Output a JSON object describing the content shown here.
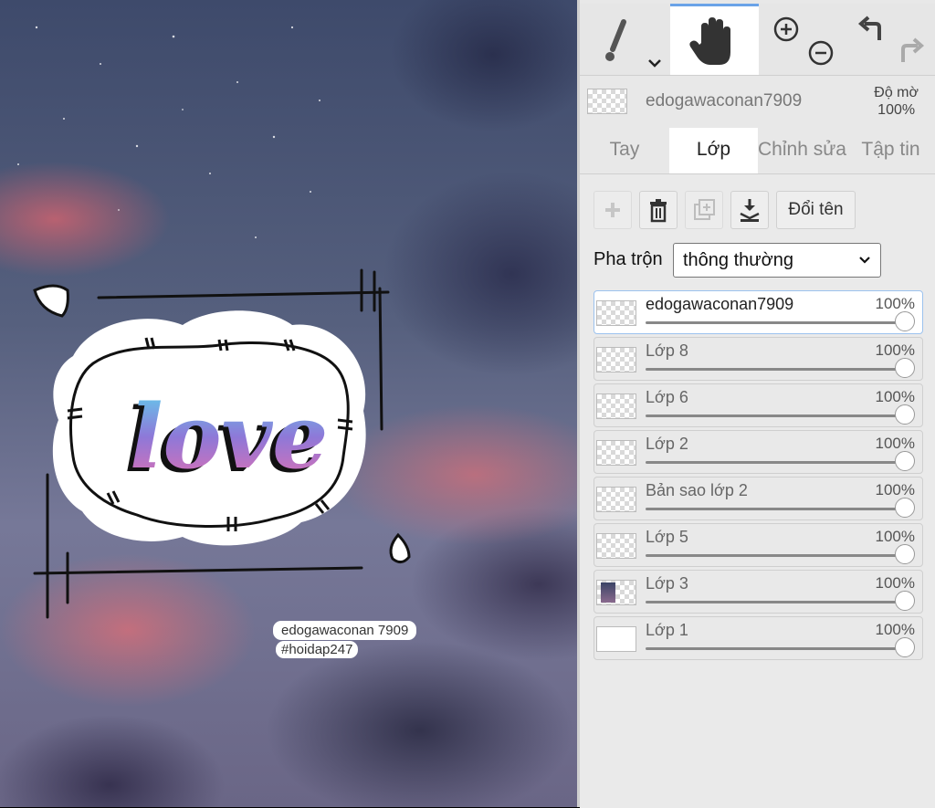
{
  "canvas": {
    "sticker_text": "love",
    "caption_line1": "edogawaconan 7909",
    "caption_line2": "#hoidap247"
  },
  "toolbar": {
    "tools": [
      {
        "name": "brush-tool",
        "icon": "brush-icon",
        "active": false
      },
      {
        "name": "hand-tool",
        "icon": "hand-icon",
        "active": true
      },
      {
        "name": "zoom-tool",
        "icon": "zoom-in-out-icon",
        "active": false
      },
      {
        "name": "undo-redo",
        "icon": "undo-redo-icon",
        "active": false
      }
    ]
  },
  "layer_info": {
    "name": "edogawaconan7909",
    "opacity_label": "Độ mờ",
    "opacity_value": "100%"
  },
  "tabs": [
    {
      "label": "Tay",
      "active": false
    },
    {
      "label": "Lớp",
      "active": true
    },
    {
      "label": "Chỉnh sửa",
      "active": false
    },
    {
      "label": "Tập tin",
      "active": false
    }
  ],
  "layer_actions": {
    "add": {
      "icon": "plus-icon",
      "enabled": false
    },
    "delete": {
      "icon": "trash-icon",
      "enabled": true
    },
    "duplicate": {
      "icon": "duplicate-icon",
      "enabled": false
    },
    "merge_down": {
      "icon": "merge-down-icon",
      "enabled": true
    },
    "rename_label": "Đổi tên"
  },
  "blend": {
    "label": "Pha trộn",
    "value": "thông thường"
  },
  "layers": [
    {
      "name": "edogawaconan7909",
      "opacity": "100%",
      "selected": true,
      "thumb": "transparent"
    },
    {
      "name": "Lớp 8",
      "opacity": "100%",
      "selected": false,
      "thumb": "transparent"
    },
    {
      "name": "Lớp 6",
      "opacity": "100%",
      "selected": false,
      "thumb": "transparent"
    },
    {
      "name": "Lớp 2",
      "opacity": "100%",
      "selected": false,
      "thumb": "transparent"
    },
    {
      "name": "Bản sao lớp 2",
      "opacity": "100%",
      "selected": false,
      "thumb": "transparent"
    },
    {
      "name": "Lớp 5",
      "opacity": "100%",
      "selected": false,
      "thumb": "transparent"
    },
    {
      "name": "Lớp 3",
      "opacity": "100%",
      "selected": false,
      "thumb": "image"
    },
    {
      "name": "Lớp 1",
      "opacity": "100%",
      "selected": false,
      "thumb": "white"
    }
  ],
  "colors": {
    "accent": "#6aa3e8",
    "panel_bg": "#e8e8e8",
    "selected_layer_border": "#9cc2ee"
  }
}
